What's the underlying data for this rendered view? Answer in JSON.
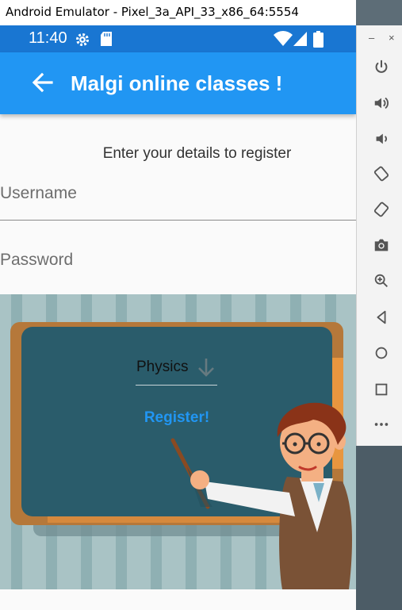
{
  "window": {
    "title": "Android Emulator - Pixel_3a_API_33_x86_64:5554"
  },
  "emulator_toolbar": {
    "minimize_label": "–",
    "close_label": "×",
    "buttons": [
      "power-icon",
      "volume-up-icon",
      "volume-down-icon",
      "rotate-left-icon",
      "rotate-right-icon",
      "camera-icon",
      "zoom-icon",
      "back-icon",
      "home-icon",
      "overview-icon",
      "more-icon"
    ]
  },
  "statusbar": {
    "time": "11:40"
  },
  "appbar": {
    "title": "Malgi online classes !"
  },
  "form": {
    "prompt": "Enter your details to register",
    "username_placeholder": "Username",
    "password_placeholder": "Password",
    "subject_value": "Physics",
    "register_label": "Register!"
  },
  "colors": {
    "appbar": "#2196f3",
    "statusbar": "#1976d2",
    "accent": "#2196f3",
    "board": "#2a5c6b",
    "board_frame": "#b5783a"
  }
}
